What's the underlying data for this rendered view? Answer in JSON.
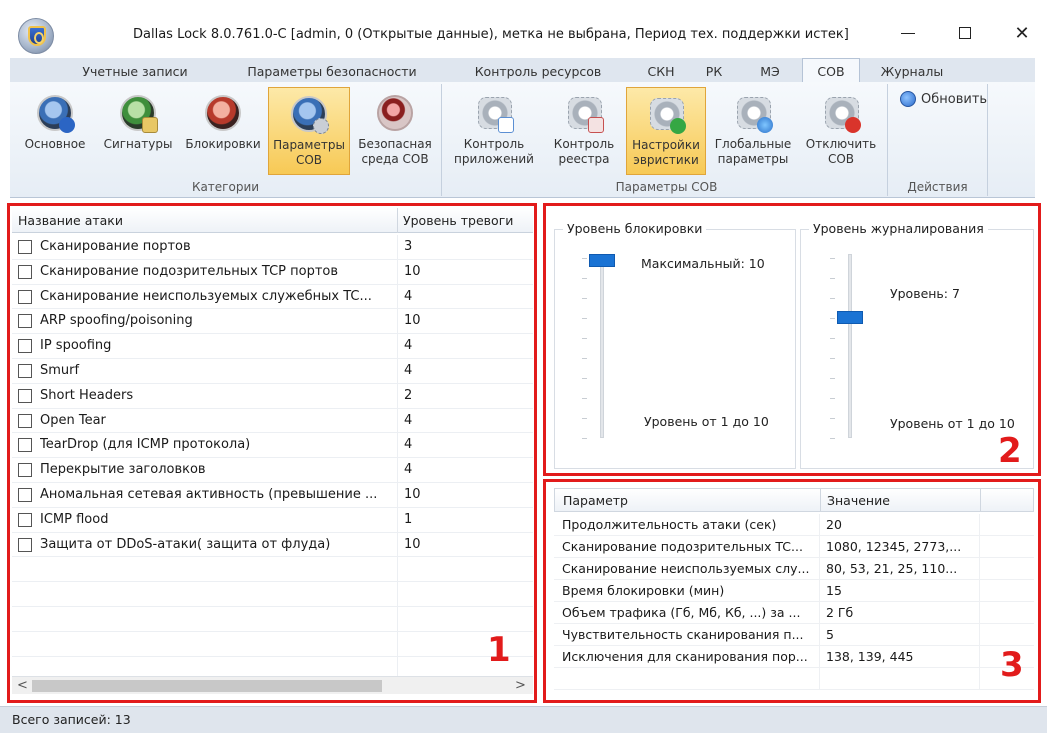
{
  "window": {
    "title": "Dallas Lock 8.0.761.0-C [admin, 0 (Открытые данные), метка не выбрана, Период тех. поддержки истек]",
    "close_glyph": "✕"
  },
  "ribbon_tabs": [
    {
      "label": "Учетные записи"
    },
    {
      "label": "Параметры безопасности"
    },
    {
      "label": "Контроль ресурсов"
    },
    {
      "label": "СКН"
    },
    {
      "label": "РК"
    },
    {
      "label": "МЭ"
    },
    {
      "label": "СОВ"
    },
    {
      "label": "Журналы"
    }
  ],
  "active_tab": "СОВ",
  "ribbon": {
    "categories": {
      "group_label": "Категории",
      "buttons": [
        {
          "label": "Основное",
          "icon": "info-orb-icon"
        },
        {
          "label": "Сигнатуры",
          "icon": "signatures-orb-icon"
        },
        {
          "label": "Блокировки",
          "icon": "block-orb-icon"
        },
        {
          "label": "Параметры\nСОВ",
          "icon": "ids-params-orb-icon",
          "selected": true
        },
        {
          "label": "Безопасная\nсреда СОВ",
          "icon": "bug-orb-icon"
        }
      ]
    },
    "ids_params": {
      "group_label": "Параметры СОВ",
      "buttons": [
        {
          "label": "Контроль\nприложений",
          "icon": "gear-window-icon"
        },
        {
          "label": "Контроль\nреестра",
          "icon": "gear-registry-icon"
        },
        {
          "label": "Настройки\nэвристики",
          "icon": "gear-add-icon",
          "selected": true
        },
        {
          "label": "Глобальные\nпараметры",
          "icon": "gear-globe-icon"
        },
        {
          "label": "Отключить\nСОВ",
          "icon": "gear-disable-icon"
        }
      ]
    },
    "actions": {
      "group_label": "Действия",
      "refresh_label": "Обновить"
    }
  },
  "attacks_table": {
    "col_name": "Название атаки",
    "col_level": "Уровень тревоги",
    "rows": [
      {
        "name": "Сканирование портов",
        "level": "3"
      },
      {
        "name": "Сканирование подозрительных TCP портов",
        "level": "10"
      },
      {
        "name": "Сканирование неиспользуемых служебных TC...",
        "level": "4"
      },
      {
        "name": "ARP spoofing/poisoning",
        "level": "10"
      },
      {
        "name": "IP spoofing",
        "level": "4"
      },
      {
        "name": "Smurf",
        "level": "4"
      },
      {
        "name": "Short Headers",
        "level": "2"
      },
      {
        "name": "Open Tear",
        "level": "4"
      },
      {
        "name": "TearDrop (для ICMP протокола)",
        "level": "4"
      },
      {
        "name": "Перекрытие заголовков",
        "level": "4"
      },
      {
        "name": "Аномальная сетевая активность (превышение ...",
        "level": "10"
      },
      {
        "name": "ICMP flood",
        "level": "1"
      },
      {
        "name": "Защита от DDoS-атаки( защита от флуда)",
        "level": "10"
      }
    ],
    "scroll_left": "<",
    "scroll_right": ">"
  },
  "sliders": {
    "block": {
      "title": "Уровень блокировки",
      "value_text": "Максимальный: 10",
      "range_text": "Уровень от 1 до 10",
      "value": 10
    },
    "log": {
      "title": "Уровень журналирования",
      "value_text": "Уровень: 7",
      "range_text": "Уровень от 1 до 10",
      "value": 7
    }
  },
  "params_table": {
    "col_param": "Параметр",
    "col_value": "Значение",
    "rows": [
      {
        "param": "Продолжительность атаки (сек)",
        "value": "20"
      },
      {
        "param": "Сканирование подозрительных TC...",
        "value": "1080, 12345, 2773,..."
      },
      {
        "param": "Сканирование неиспользуемых слу...",
        "value": "80, 53, 21, 25, 110..."
      },
      {
        "param": "Время блокировки (мин)",
        "value": "15"
      },
      {
        "param": "Объем трафика (Гб, Мб, Кб, ...) за ...",
        "value": "2 Гб"
      },
      {
        "param": "Чувствительность сканирования п...",
        "value": "5"
      },
      {
        "param": "Исключения для сканирования пор...",
        "value": "138, 139, 445"
      }
    ]
  },
  "panel_numbers": [
    "1",
    "2",
    "3"
  ],
  "status": {
    "text": "Всего записей: 13"
  },
  "colors": {
    "annotation_red": "#e21b1b",
    "slider_thumb": "#1a73d4",
    "selected_button": "#f7c955"
  }
}
